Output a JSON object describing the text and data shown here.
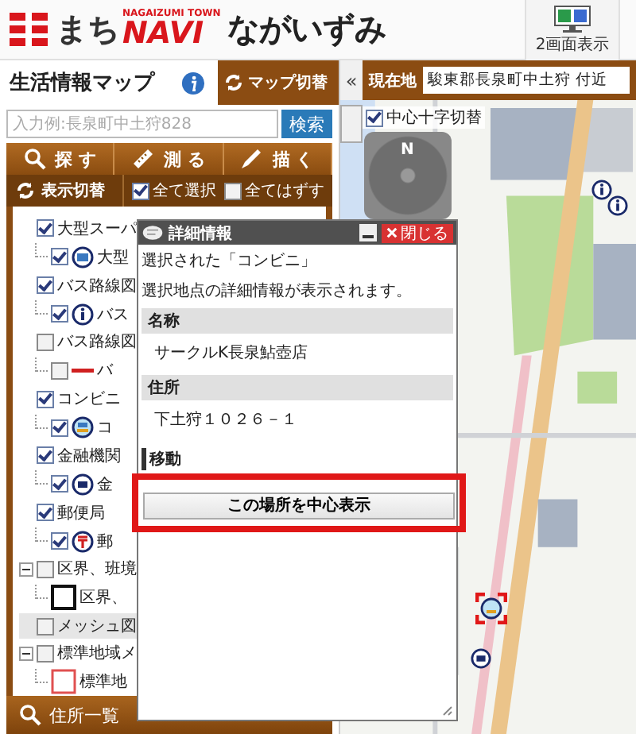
{
  "header": {
    "logo": {
      "prefix": "まち",
      "brand": "NAVI",
      "tagline": "NAGAIZUMI TOWN",
      "town": "ながいずみ"
    },
    "dual_screen_button": "2画面表示"
  },
  "sidebar": {
    "title": "生活情報マップ",
    "map_switch": "マップ切替",
    "search": {
      "placeholder": "入力例:長泉町中土狩828",
      "button": "検索"
    },
    "tools": [
      {
        "label": "探 す"
      },
      {
        "label": "測 る"
      },
      {
        "label": "描 く"
      }
    ],
    "display_toggle": "表示切替",
    "select_all": {
      "label": "全て選択",
      "checked": true
    },
    "deselect_all": {
      "label": "全てはずす",
      "checked": false
    },
    "layers": [
      {
        "label": "大型スーパ",
        "checked": true,
        "selected": false,
        "children": [
          {
            "label": "大型",
            "checked": true,
            "kind": "shop"
          }
        ]
      },
      {
        "label": "バス路線図",
        "checked": true,
        "selected": false,
        "children": [
          {
            "label": "バス",
            "checked": true,
            "kind": "info"
          }
        ]
      },
      {
        "label": "バス路線図",
        "checked": false,
        "selected": false,
        "children": [
          {
            "label": "バ",
            "checked": false,
            "kind": "line"
          }
        ]
      },
      {
        "label": "コンビニ",
        "checked": true,
        "selected": false,
        "children": [
          {
            "label": "コ",
            "checked": true,
            "kind": "store"
          }
        ]
      },
      {
        "label": "金融機関",
        "checked": true,
        "selected": false,
        "children": [
          {
            "label": "金",
            "checked": true,
            "kind": "bank"
          }
        ]
      },
      {
        "label": "郵便局",
        "checked": true,
        "selected": false,
        "children": [
          {
            "label": "郵",
            "checked": true,
            "kind": "post"
          }
        ]
      },
      {
        "label": "区界、班境",
        "checked": false,
        "selected": false,
        "expanded": true,
        "children": [
          {
            "label": "区界、",
            "kind": "square"
          }
        ]
      },
      {
        "label": "メッシュ図",
        "checked": false,
        "selected": true
      },
      {
        "label": "標準地域メ",
        "checked": false,
        "selected": false,
        "expanded": true,
        "children": [
          {
            "label": "標準地",
            "kind": "red-square"
          }
        ]
      }
    ],
    "footer": "住所一覧"
  },
  "map": {
    "collapse_button": "«",
    "location_label": "現在地",
    "location_value": "駿東郡長泉町中土狩 付近",
    "crosshair": {
      "label": "中心十字切替",
      "checked": true
    },
    "compass_north": "N"
  },
  "dialog": {
    "title": "詳細情報",
    "close_button": "閉じる",
    "lines": [
      "選択された「コンビニ」",
      "選択地点の詳細情報が表示されます。"
    ],
    "sections": [
      {
        "heading": "名称",
        "value": "サークルK長泉鮎壺店"
      },
      {
        "heading": "住所",
        "value": "下土狩１０２６－１"
      }
    ],
    "move_heading": "移動",
    "center_button": {
      "label": "この場所を中心表示",
      "highlighted": true
    }
  }
}
